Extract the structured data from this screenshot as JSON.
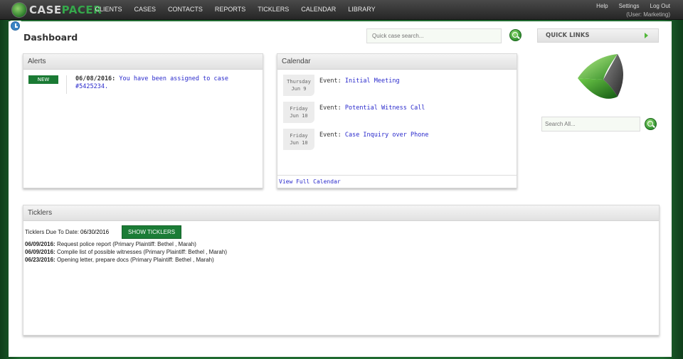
{
  "app": {
    "brand_case": "CASE",
    "brand_pacer": "PACER"
  },
  "nav": {
    "items": [
      "CLIENTS",
      "CASES",
      "CONTACTS",
      "REPORTS",
      "TICKLERS",
      "CALENDAR",
      "LIBRARY"
    ]
  },
  "top_right": {
    "help": "Help",
    "settings": "Settings",
    "logout": "Log Out",
    "user": "(User: Marketing)"
  },
  "page": {
    "title": "Dashboard"
  },
  "search": {
    "quick_placeholder": "Quick case search...",
    "all_placeholder": "Search All..."
  },
  "quick_links": {
    "label": "QUICK LINKS"
  },
  "alerts": {
    "title": "Alerts",
    "items": [
      {
        "badge": "NEW",
        "date": "06/08/2016:",
        "text": "You have been assigned to case #5425234."
      }
    ]
  },
  "calendar": {
    "title": "Calendar",
    "event_prefix": "Event:",
    "events": [
      {
        "day": "Thursday",
        "date": "Jun 9",
        "title": "Initial Meeting"
      },
      {
        "day": "Friday",
        "date": "Jun 10",
        "title": "Potential Witness Call"
      },
      {
        "day": "Friday",
        "date": "Jun 10",
        "title": "Case Inquiry over Phone"
      }
    ],
    "footer_link": "View Full Calendar"
  },
  "ticklers": {
    "title": "Ticklers",
    "due_label": "Ticklers Due To Date:",
    "due_value": "06/30/2016",
    "button": "SHOW TICKLERS",
    "items": [
      {
        "date": "06/09/2016:",
        "text": "Request police report (Primary Plaintiff: Bethel , Marah)"
      },
      {
        "date": "06/09/2016:",
        "text": "Compile list of possible witnesses (Primary Plaintiff: Bethel , Marah)"
      },
      {
        "date": "06/23/2016:",
        "text": "Opening letter, prepare docs (Primary Plaintiff: Bethel , Marah)"
      }
    ]
  },
  "colors": {
    "brand_green": "#1b7c36",
    "link_blue": "#2a2acc",
    "nav_bg": "#303030"
  }
}
